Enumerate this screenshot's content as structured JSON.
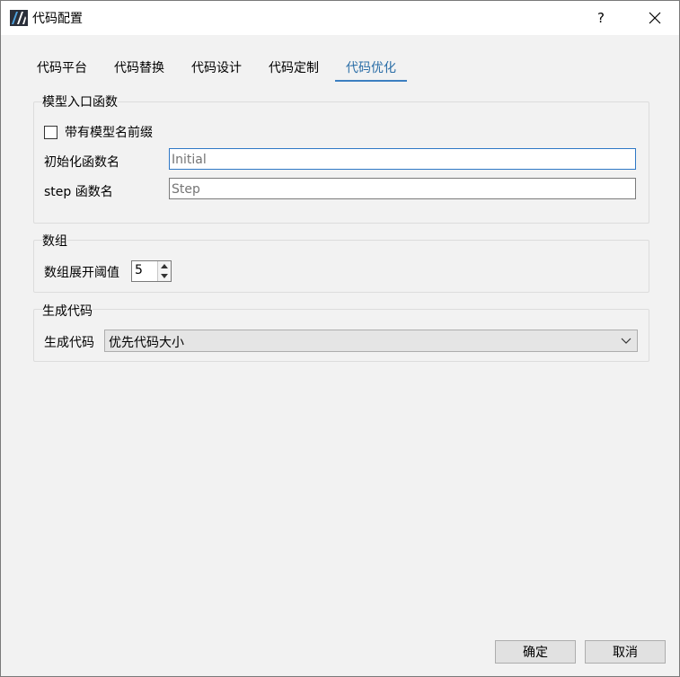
{
  "window": {
    "title": "代码配置",
    "help_label": "?"
  },
  "tabs": [
    {
      "label": "代码平台",
      "active": false
    },
    {
      "label": "代码替换",
      "active": false
    },
    {
      "label": "代码设计",
      "active": false
    },
    {
      "label": "代码定制",
      "active": false
    },
    {
      "label": "代码优化",
      "active": true
    }
  ],
  "model_entry": {
    "group_title": "模型入口函数",
    "prefix_checkbox_label": "带有模型名前缀",
    "prefix_checked": false,
    "init_label": "初始化函数名",
    "init_placeholder": "Initial",
    "step_label": "step 函数名",
    "step_placeholder": "Step"
  },
  "array": {
    "group_title": "数组",
    "threshold_label": "数组展开阈值",
    "threshold_value": "5"
  },
  "codegen": {
    "group_title": "生成代码",
    "label": "生成代码",
    "selected": "优先代码大小"
  },
  "buttons": {
    "ok": "确定",
    "cancel": "取消"
  },
  "colors": {
    "accent": "#3c7fc1",
    "active_tab_text": "#2b6ea7",
    "focus_border": "#2f78c6"
  }
}
